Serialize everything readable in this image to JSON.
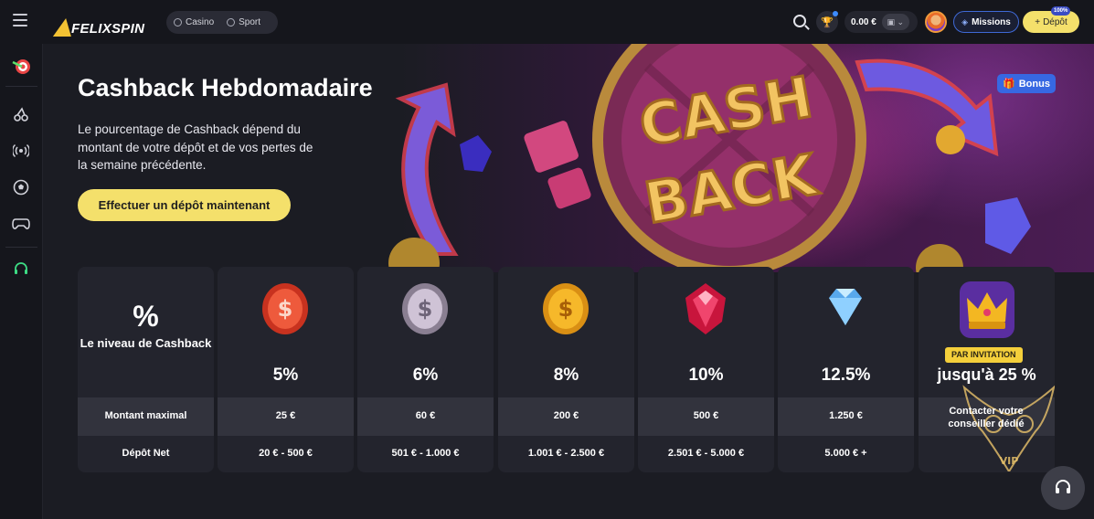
{
  "header": {
    "logo_text": "FELIXSPIN",
    "nav": [
      {
        "label": "Casino",
        "icon": "casino-icon"
      },
      {
        "label": "Sport",
        "icon": "sport-icon"
      }
    ],
    "balance": "0.00 €",
    "missions_label": "Missions",
    "depot_label": "Dépôt",
    "depot_badge": "100%",
    "accent_color": "#f4e06b"
  },
  "sidebar": {
    "items": [
      {
        "name": "target-icon"
      },
      {
        "name": "cherries-icon"
      },
      {
        "name": "live-icon"
      },
      {
        "name": "football-icon"
      },
      {
        "name": "gamepad-icon"
      },
      {
        "name": "support-headset-icon"
      }
    ]
  },
  "hero": {
    "title": "Cashback Hebdomadaire",
    "description": "Le pourcentage de Cashback dépend du montant de votre dépôt et de vos pertes de la semaine précédente.",
    "cta_label": "Effectuer un dépôt maintenant",
    "bonus_label": "Bonus",
    "art_text_1": "CASH",
    "art_text_2": "BACK"
  },
  "table": {
    "header_symbol": "%",
    "header_label": "Le niveau de Cashback",
    "row_max_label": "Montant maximal",
    "row_depot_label": "Dépôt Net",
    "levels": [
      {
        "icon": "red-coin-icon",
        "percent": "5%",
        "max": "25 €",
        "depot": "20 € - 500 €"
      },
      {
        "icon": "silver-coin-icon",
        "percent": "6%",
        "max": "60 €",
        "depot": "501 € - 1.000 €"
      },
      {
        "icon": "gold-coin-icon",
        "percent": "8%",
        "max": "200 €",
        "depot": "1.001 € - 2.500 €"
      },
      {
        "icon": "ruby-icon",
        "percent": "10%",
        "max": "500 €",
        "depot": "2.501 € - 5.000 €"
      },
      {
        "icon": "diamond-icon",
        "percent": "12.5%",
        "max": "1.250 €",
        "depot": "5.000 € +"
      }
    ],
    "vip": {
      "badge": "PAR INVITATION",
      "percent": "jusqu'à 25 %",
      "contact": "Contacter votre conseiller dédié",
      "mark_text": "VIP"
    }
  }
}
